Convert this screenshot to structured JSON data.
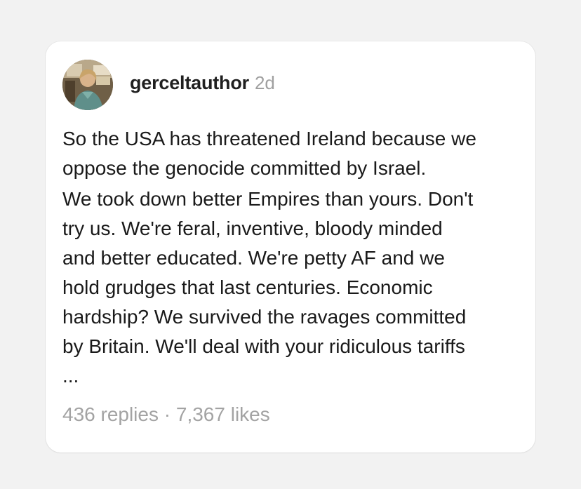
{
  "post": {
    "username": "gerceltauthor",
    "time": "2d",
    "paragraphs": [
      "So the USA has threatened Ireland because we\noppose the genocide committed by Israel.",
      "We took down better Empires than yours. Don't\ntry us. We're feral, inventive, bloody minded\nand better educated.  We're petty AF and we\nhold grudges that last centuries. Economic\nhardship? We survived the ravages committed\nby Britain. We'll deal with your ridiculous tariffs\n..."
    ],
    "replies": "436 replies",
    "separator": " · ",
    "likes": "7,367 likes"
  },
  "colors": {
    "background": "#f2f2f2",
    "card": "#ffffff",
    "text": "#1a1a1a",
    "muted": "#a0a0a0"
  },
  "icons": {
    "avatar": "user-avatar-photo"
  }
}
